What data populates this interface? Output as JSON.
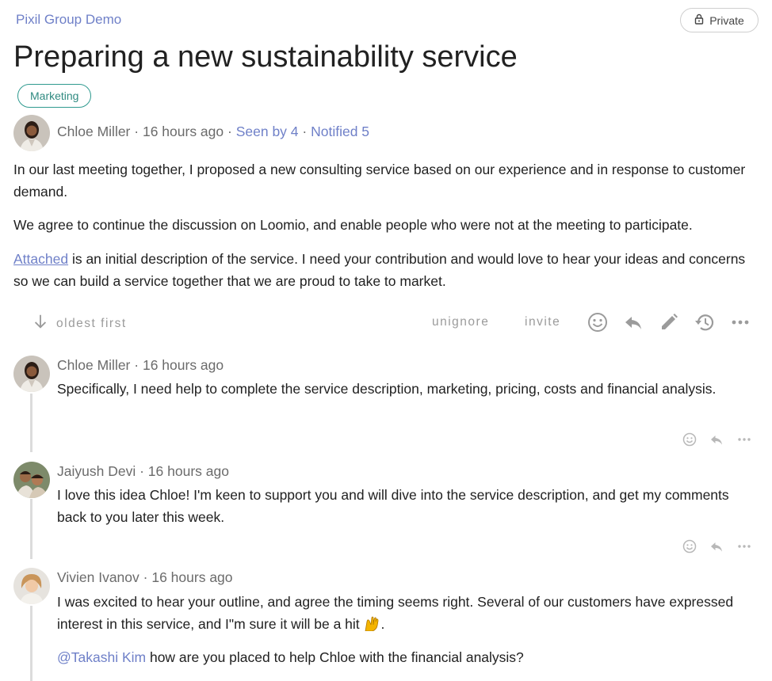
{
  "group": {
    "name": "Pixil Group Demo"
  },
  "privacy": {
    "label": "Private",
    "icon": "lock-icon"
  },
  "discussion": {
    "title": "Preparing a new sustainability service",
    "tag": "Marketing",
    "author": "Chloe Miller",
    "time": "16 hours ago",
    "seen": "Seen by 4",
    "notified": "Notified 5",
    "separator": "·",
    "paragraphs": [
      "In our last meeting together, I proposed a new consulting service based on our experience and in response to customer demand.",
      "We agree to continue the discussion on Loomio, and enable people who were not at the meeting to participate."
    ],
    "p3_link": "Attached",
    "p3_rest": " is an initial description of the service. I need your contribution and would love to hear your ideas and concerns so we can build a service together that we are proud to take to market."
  },
  "actions": {
    "sort_label": "oldest first",
    "unignore_label": "unignore",
    "invite_label": "invite",
    "icons": [
      "arrow-down-icon",
      "emoji-icon",
      "reply-icon",
      "edit-icon",
      "history-icon",
      "more-icon"
    ]
  },
  "comments": [
    {
      "author": "Chloe Miller",
      "time": "16 hours ago",
      "text": "Specifically, I need help to complete the service description, marketing, pricing, costs and financial analysis."
    },
    {
      "author": "Jaiyush Devi",
      "time": "16 hours ago",
      "text": "I love this idea Chloe! I'm keen to support you and will dive into the service description, and get my comments back to you later this week."
    },
    {
      "author": "Vivien Ivanov",
      "time": "16 hours ago",
      "text": "I was excited to hear your outline, and agree the timing seems right. Several of our customers have expressed interest in this service, and I\"m sure it will be a hit",
      "text_end": ".",
      "mention": "@Takashi Kim",
      "mention_rest": " how are you placed to help Chloe with the financial analysis?"
    }
  ],
  "colors": {
    "link": "#6f80c8",
    "tag_border": "#2f9a8f",
    "muted": "#9b9b9b",
    "text": "#212121"
  }
}
